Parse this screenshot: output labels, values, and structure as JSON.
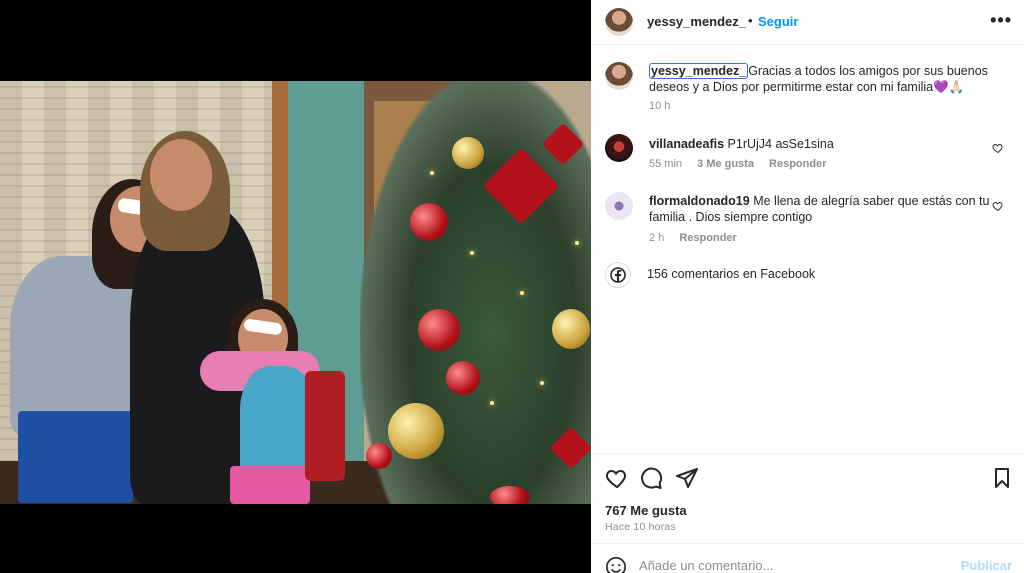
{
  "post": {
    "author": "yessy_mendez_",
    "follow_label": "Seguir",
    "dot": "•",
    "more_label": "•••"
  },
  "caption": {
    "username": "yessy_mendez_",
    "text": "Gracias a todos los amigos por sus buenos deseos y a Dios por permitirme estar con mi familia💜🙏🏻",
    "time": "10 h"
  },
  "comments": [
    {
      "username": "villanadeafis",
      "text": "P1rUjJ4 asSe1sina",
      "time": "55 min",
      "likes": "3 Me gusta",
      "reply": "Responder"
    },
    {
      "username": "flormaldonado19",
      "text": "Me llena de alegría saber que estás con tu familia . Dios siempre contigo",
      "time": "2 h",
      "reply": "Responder"
    }
  ],
  "facebook": {
    "icon": "facebook-icon",
    "text": "156 comentarios en Facebook"
  },
  "actions": {
    "likes": "767 Me gusta",
    "posted": "Hace 10 horas"
  },
  "add_comment": {
    "placeholder": "Añade un comentario...",
    "publish": "Publicar"
  },
  "colors": {
    "link": "#0095f6",
    "publish_disabled": "#b3dbff",
    "muted": "#8e8e8e"
  }
}
